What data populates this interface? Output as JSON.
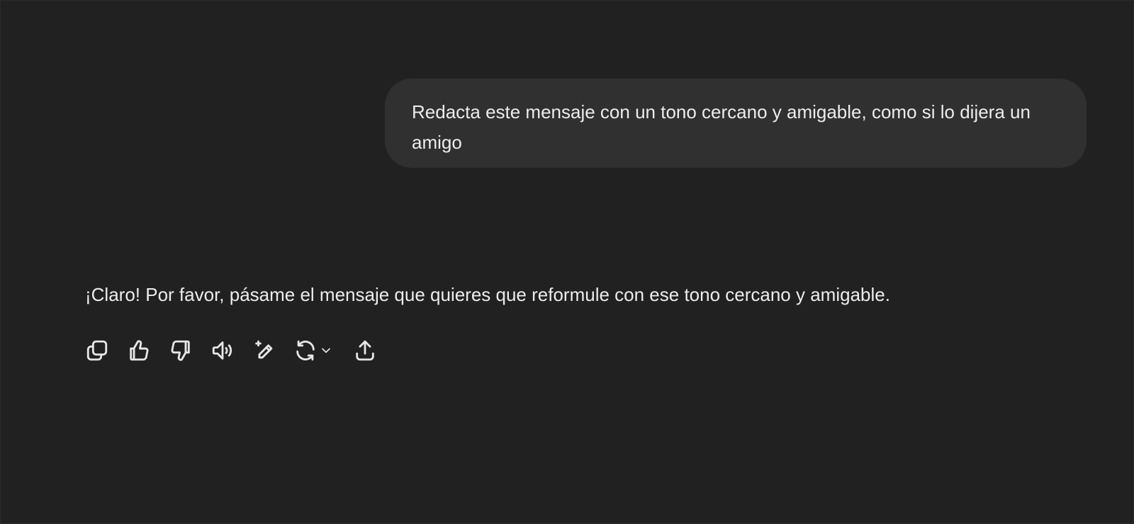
{
  "conversation": {
    "user_message": "Redacta este mensaje con un tono cercano y amigable, como si lo dijera un amigo",
    "assistant_message": "¡Claro! Por favor, pásame el mensaje que quieres que reformule con ese tono cercano y amigable."
  },
  "actions": [
    {
      "name": "copy",
      "icon": "copy-icon"
    },
    {
      "name": "good-response",
      "icon": "thumbs-up-icon"
    },
    {
      "name": "bad-response",
      "icon": "thumbs-down-icon"
    },
    {
      "name": "read-aloud",
      "icon": "speaker-icon"
    },
    {
      "name": "edit-in-canvas",
      "icon": "pen-sparkle-icon"
    },
    {
      "name": "regenerate",
      "icon": "refresh-icon"
    },
    {
      "name": "share",
      "icon": "share-upload-icon"
    }
  ],
  "colors": {
    "background": "#212121",
    "user_bubble": "#303030",
    "text": "#ececec"
  }
}
